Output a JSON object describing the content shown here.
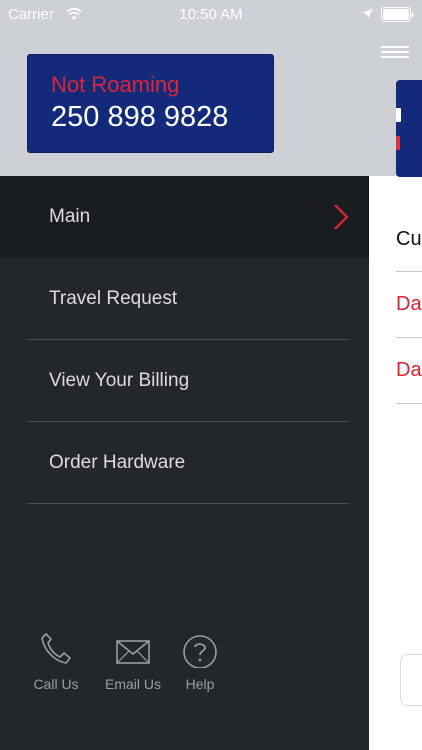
{
  "status_bar": {
    "carrier": "Carrier",
    "time": "10:50 AM"
  },
  "account": {
    "roaming_status": "Not Roaming",
    "phone_number": "250 898 9828"
  },
  "menu": {
    "items": [
      {
        "label": "Main",
        "active": true
      },
      {
        "label": "Travel Request",
        "active": false
      },
      {
        "label": "View Your Billing",
        "active": false
      },
      {
        "label": "Order Hardware",
        "active": false
      }
    ]
  },
  "footer": {
    "call_label": "Call Us",
    "email_label": "Email Us",
    "help_label": "Help"
  },
  "background_panel": {
    "heading_partial": "Cu",
    "row1_partial": "Da",
    "row2_partial": "Da"
  },
  "colors": {
    "accent_red": "#e02438",
    "card_blue": "#13297a",
    "drawer_bg": "#23272b"
  }
}
